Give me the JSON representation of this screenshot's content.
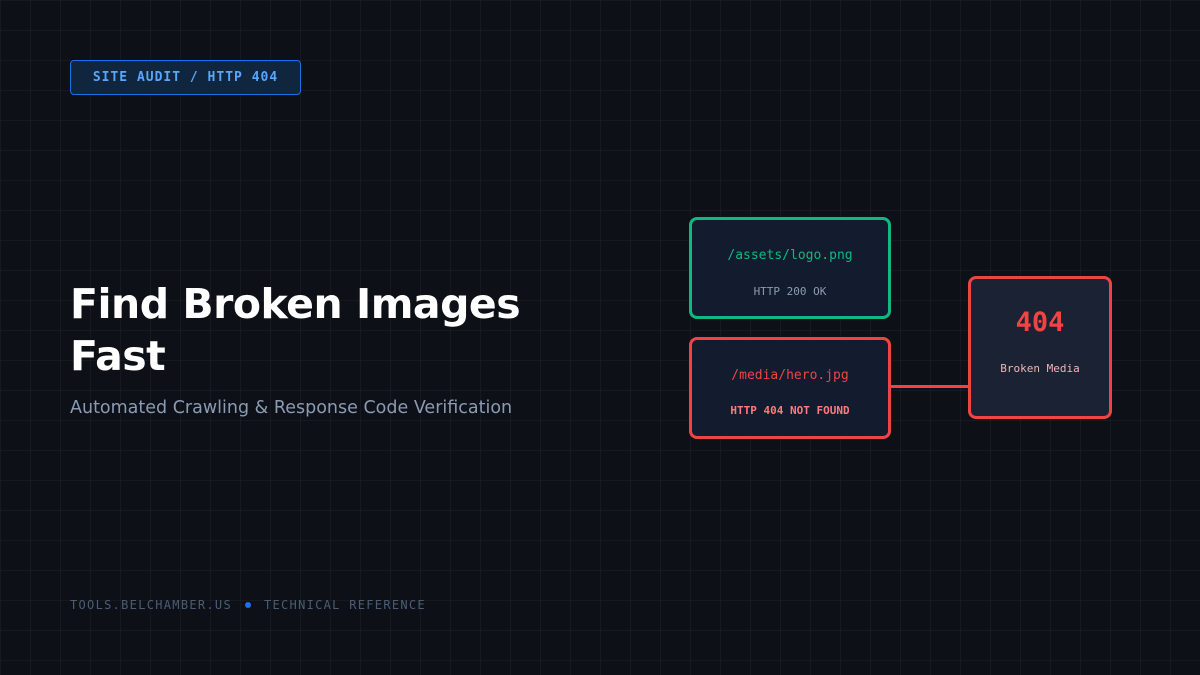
{
  "badge": "SITE AUDIT / HTTP 404",
  "title_lines": [
    "Find Broken Images",
    "Fast"
  ],
  "subtitle": "Automated Crawling & Response Code Verification",
  "footer": {
    "site": "TOOLS.BELCHAMBER.US",
    "section": "TECHNICAL REFERENCE"
  },
  "diagram": {
    "ok_node": {
      "path": "/assets/logo.png",
      "status": "HTTP 200 OK"
    },
    "broken_node": {
      "path": "/media/hero.jpg",
      "status": "HTTP 404 NOT FOUND"
    },
    "result_node": {
      "code": "404",
      "label": "Broken Media"
    }
  },
  "colors": {
    "background": "#0d1117",
    "accent_blue": "#58a6ff",
    "success_green": "#10b981",
    "error_red": "#ef4444"
  }
}
